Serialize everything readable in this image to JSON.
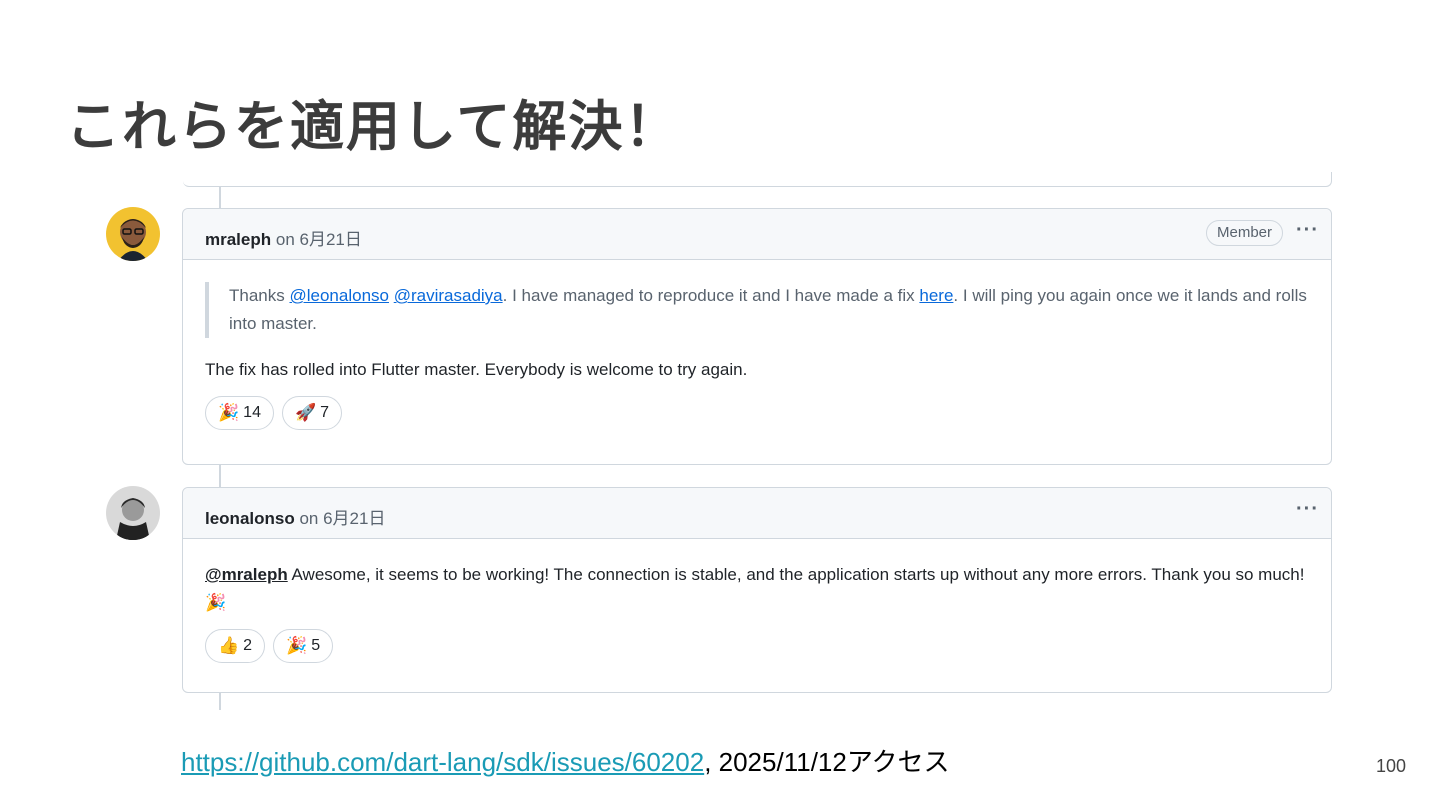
{
  "slide": {
    "title": "これらを適用して解決！",
    "page_number": "100"
  },
  "comments": [
    {
      "author": "mraleph",
      "date": "on 6月21日",
      "badge": "Member",
      "menu_icon": "···",
      "quote": {
        "prefix": "Thanks ",
        "mention1": "@leonalonso",
        "space": " ",
        "mention2": "@ravirasadiya",
        "middle": ". I have managed to reproduce it and I have made a fix ",
        "link": "here",
        "suffix": ". I will ping you again once we it lands and rolls into master."
      },
      "text": "The fix has rolled into Flutter master. Everybody is welcome to try again.",
      "reactions": [
        {
          "emoji": "🎉",
          "icon": "tada-icon",
          "count": "14"
        },
        {
          "emoji": "🚀",
          "icon": "rocket-icon",
          "count": "7"
        }
      ]
    },
    {
      "author": "leonalonso",
      "date": "on 6月21日",
      "menu_icon": "···",
      "mention": "@mraleph",
      "text": " Awesome, it seems to be working! The connection is stable, and the application starts up without any more errors. Thank you so much! ",
      "text_emoji": "🎉",
      "reactions": [
        {
          "emoji": "👍",
          "icon": "thumbs-up-icon",
          "count": "2"
        },
        {
          "emoji": "🎉",
          "icon": "tada-icon",
          "count": "5"
        }
      ]
    }
  ],
  "footer": {
    "url": "https://github.com/dart-lang/sdk/issues/60202",
    "suffix": ", 2025/11/12アクセス"
  },
  "colors": {
    "link": "#0969da",
    "border": "#d0d7de",
    "header_bg": "#f6f8fa",
    "footer_link": "#1a9bb5"
  }
}
